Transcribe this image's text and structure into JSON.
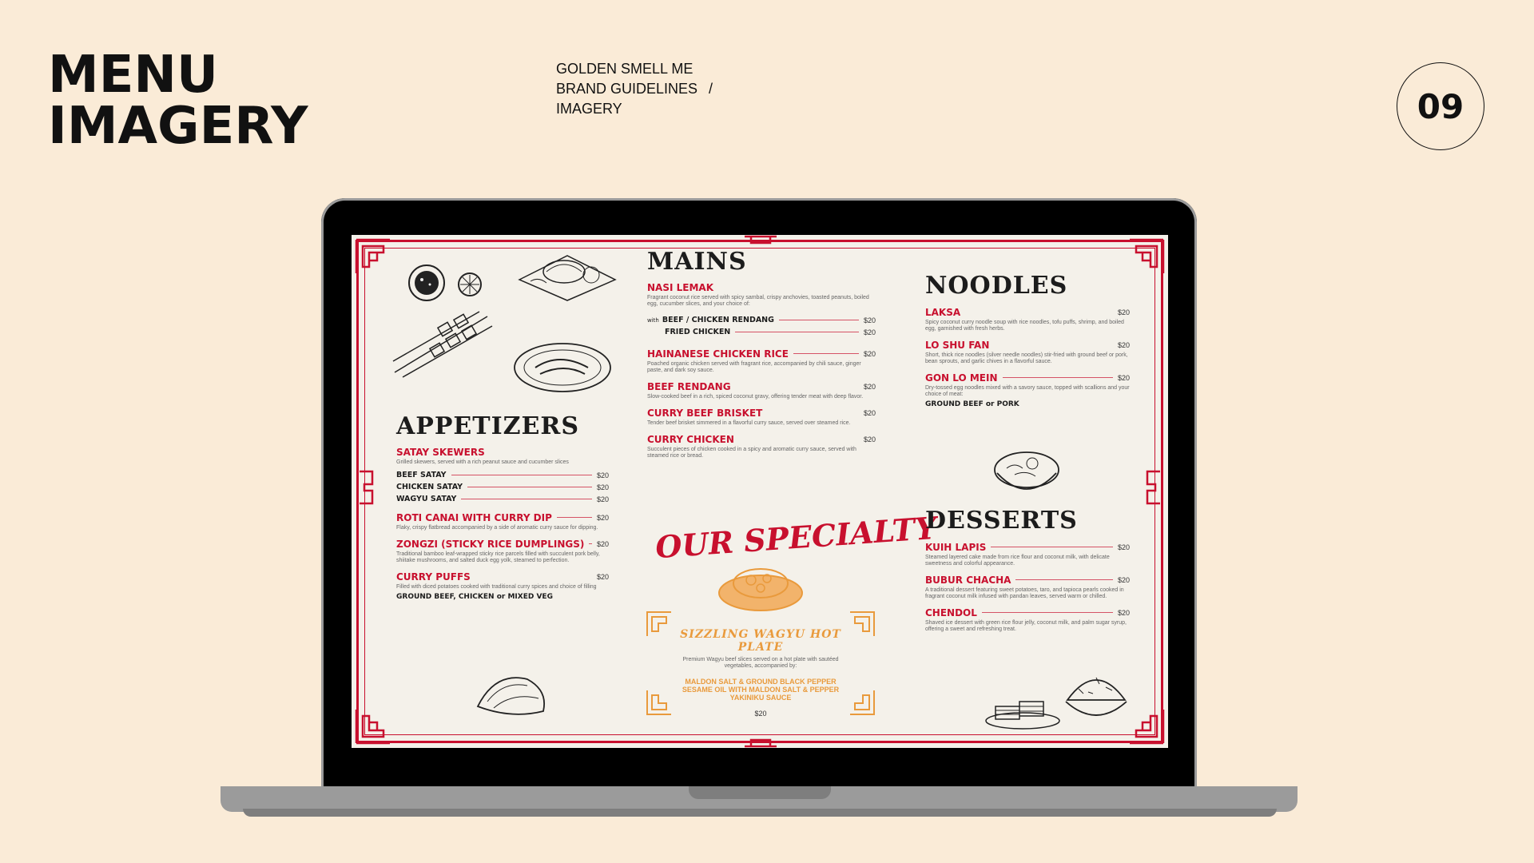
{
  "header": {
    "title_line1": "MENU",
    "title_line2": "IMAGERY",
    "brand": "GOLDEN SMELL ME",
    "section": "BRAND GUIDELINES",
    "separator": "/",
    "subsection": "IMAGERY",
    "page_number": "09"
  },
  "menu": {
    "appetizers": {
      "heading": "APPETIZERS",
      "items": [
        {
          "name": "SATAY SKEWERS",
          "desc": "Grilled skewers, served with a rich peanut sauce and cucumber slices",
          "options": [
            {
              "name": "BEEF SATAY",
              "price": "$20"
            },
            {
              "name": "CHICKEN SATAY",
              "price": "$20"
            },
            {
              "name": "WAGYU SATAY",
              "price": "$20"
            }
          ]
        },
        {
          "name": "ROTI CANAI WITH CURRY DIP",
          "price": "$20",
          "desc": "Flaky, crispy flatbread accompanied by a side of aromatic curry sauce for dipping."
        },
        {
          "name": "ZONGZI (STICKY RICE DUMPLINGS)",
          "price": "$20",
          "desc": "Traditional bamboo leaf-wrapped sticky rice parcels filled with succulent pork belly, shiitake mushrooms, and salted duck egg yolk, steamed to perfection."
        },
        {
          "name": "CURRY PUFFS",
          "price": "$20",
          "desc": "Filled with diced potatoes cooked with traditional curry spices and choice of filling",
          "sub": "GROUND BEEF, CHICKEN or MIXED VEG"
        }
      ]
    },
    "mains": {
      "heading": "MAINS",
      "items": [
        {
          "name": "NASI LEMAK",
          "desc": "Fragrant coconut rice served with spicy sambal, crispy anchovies, toasted peanuts, boiled egg, cucumber slices, and your choice of:",
          "options_prefix": "with",
          "options": [
            {
              "name": "BEEF / CHICKEN RENDANG",
              "price": "$20"
            },
            {
              "name": "FRIED CHICKEN",
              "price": "$20"
            }
          ]
        },
        {
          "name": "HAINANESE CHICKEN RICE",
          "price": "$20",
          "desc": "Poached organic chicken served with fragrant rice, accompanied by chili sauce, ginger paste, and dark soy sauce."
        },
        {
          "name": "BEEF RENDANG",
          "price": "$20",
          "desc": "Slow-cooked beef in a rich, spiced coconut gravy, offering tender meat with deep flavor."
        },
        {
          "name": "CURRY BEEF BRISKET",
          "price": "$20",
          "desc": "Tender beef brisket simmered in a flavorful curry sauce, served over steamed rice."
        },
        {
          "name": "CURRY CHICKEN",
          "price": "$20",
          "desc": "Succulent pieces of chicken cooked in a spicy and aromatic curry sauce, served with steamed rice or bread."
        }
      ]
    },
    "special": {
      "title": "OUR SPECIALTY",
      "name": "SIZZLING WAGYU HOT PLATE",
      "desc": "Premium Wagyu beef slices served on a hot plate with sautéed vegetables, accompanied by:",
      "sauces": [
        "MALDON SALT & GROUND BLACK PEPPER",
        "SESAME OIL WITH MALDON SALT & PEPPER",
        "YAKINIKU SAUCE"
      ],
      "price": "$20"
    },
    "noodles": {
      "heading": "NOODLES",
      "items": [
        {
          "name": "LAKSA",
          "price": "$20",
          "desc": "Spicy coconut curry noodle soup with rice noodles, tofu puffs, shrimp, and boiled egg, garnished with fresh herbs."
        },
        {
          "name": "LO SHU FAN",
          "price": "$20",
          "desc": "Short, thick rice noodles (silver needle noodles) stir-fried with ground beef or pork, bean sprouts, and garlic chives in a flavorful sauce."
        },
        {
          "name": "GON LO MEIN",
          "price": "$20",
          "desc": "Dry-tossed egg noodles mixed with a savory sauce, topped with scallions and your choice of meat:",
          "sub": "GROUND BEEF or PORK"
        }
      ]
    },
    "desserts": {
      "heading": "DESSERTS",
      "items": [
        {
          "name": "KUIH LAPIS",
          "price": "$20",
          "desc": "Steamed layered cake made from rice flour and coconut milk, with delicate sweetness and colorful appearance."
        },
        {
          "name": "BUBUR CHACHA",
          "price": "$20",
          "desc": "A traditional dessert featuring sweet potatoes, taro, and tapioca pearls cooked in fragrant coconut milk infused with pandan leaves, served warm or chilled."
        },
        {
          "name": "CHENDOL",
          "price": "$20",
          "desc": "Shaved ice dessert with green rice flour jelly, coconut milk, and palm sugar syrup, offering a sweet and refreshing treat."
        }
      ]
    }
  },
  "colors": {
    "background": "#FAEBD7",
    "menu_red": "#C8102E",
    "menu_orange": "#E99A3C",
    "paper": "#F4F1EA"
  },
  "icons": [
    "laptop-frame",
    "corner-ornament",
    "food-sketch"
  ]
}
